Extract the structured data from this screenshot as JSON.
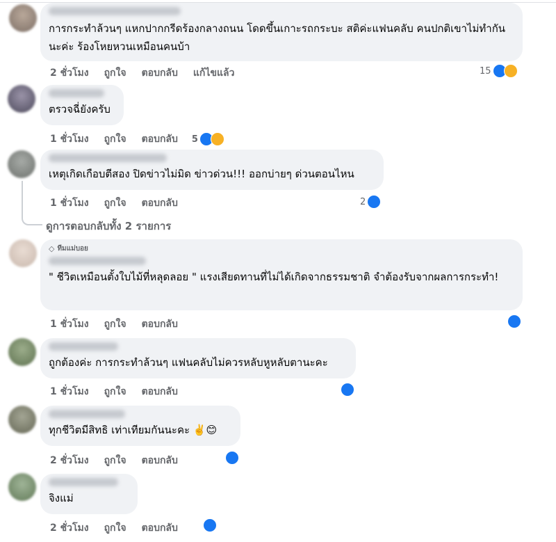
{
  "comments": [
    {
      "text": "การกระทำล้วนๆ แหกปากกรีดร้องกลางถนน โดดขึ้นเกาะรถกระบะ สติค่ะแฟนคลับ คนปกติเขาไม่ทำกันนะค่ะ ร้องโหยหวนเหมือนคนบ้า",
      "time": "2 ชั่วโมง",
      "like": "ถูกใจ",
      "reply": "ตอบกลับ",
      "edited": "แก้ไขแล้ว",
      "reaction_count": "15",
      "reactions": [
        "like",
        "haha"
      ]
    },
    {
      "text": "ตรวจฉี่ยังครับ",
      "time": "1 ชั่วโมง",
      "like": "ถูกใจ",
      "reply": "ตอบกลับ",
      "reaction_count": "5",
      "reactions": [
        "like",
        "haha"
      ]
    },
    {
      "text": "เหตุเกิดเกือบตีสอง ปิดข่าวไม่มิด ข่าวด่วน!!! ออกบ่ายๆ ด่วนตอนไหน",
      "time": "1 ชั่วโมง",
      "like": "ถูกใจ",
      "reply": "ตอบกลับ",
      "reaction_count": "2",
      "reactions": [
        "like"
      ]
    },
    {
      "badge": "ทีมแม่บอย",
      "text": "\" ชีวิตเหมือนตั้งใบไม้ที่หลุดลอย \" แรงเสียดทานที่ไม่ได้เกิดจากธรรมชาติ จำต้องรับจากผลการกระทำ!",
      "time": "1 ชั่วโมง",
      "like": "ถูกใจ",
      "reply": "ตอบกลับ",
      "reactions": [
        "like"
      ]
    },
    {
      "text": "ถูกต้องค่ะ การกระทำล้วนๆ แฟนคลับไม่ควรหลับหูหลับตานะคะ",
      "time": "1 ชั่วโมง",
      "like": "ถูกใจ",
      "reply": "ตอบกลับ",
      "reactions": [
        "like"
      ]
    },
    {
      "text": "ทุกชีวิตมีสิทธิ เท่าเทียมกันนะคะ",
      "emoji": "✌️😊",
      "time": "2 ชั่วโมง",
      "like": "ถูกใจ",
      "reply": "ตอบกลับ",
      "reactions": [
        "like"
      ]
    },
    {
      "text": "จิงแม่",
      "time": "2 ชั่วโมง",
      "like": "ถูกใจ",
      "reply": "ตอบกลับ",
      "reactions": [
        "like"
      ]
    }
  ],
  "view_replies": "ดูการตอบกลับทั้ง 2 รายการ",
  "colors": {
    "like": "#1877f2",
    "haha": "#f7b125",
    "bubble": "#f0f2f5",
    "meta": "#65676b"
  }
}
